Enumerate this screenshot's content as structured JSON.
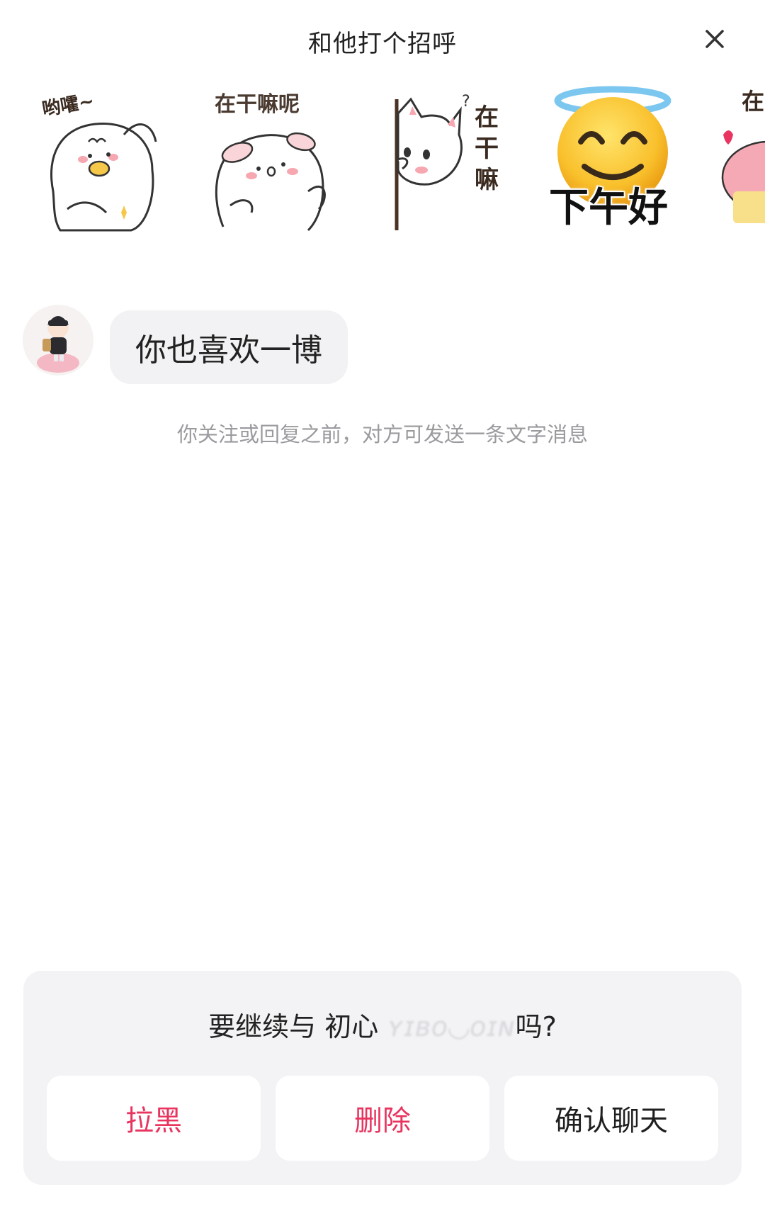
{
  "header": {
    "title": "和他打个招呼",
    "close_icon": "close-icon"
  },
  "stickers": [
    {
      "name": "duck-sticker",
      "caption": "哟嚯~"
    },
    {
      "name": "bunny-sticker",
      "caption": "在干嘛呢"
    },
    {
      "name": "cat-sticker",
      "caption": "在干嘛"
    },
    {
      "name": "angel-emoji-sticker",
      "caption": "下午好"
    },
    {
      "name": "pig-sticker",
      "caption": "在"
    }
  ],
  "chat": {
    "avatar_icon": "user-avatar",
    "message": "你也喜欢一博"
  },
  "hint": "你关注或回复之前，对方可发送一条文字消息",
  "prompt": {
    "prefix": "要继续与 初心 ",
    "name_blurred": "ʏɪʙᴏ◡ᴏɪɴ",
    "suffix": "吗?"
  },
  "actions": {
    "block": "拉黑",
    "delete": "删除",
    "confirm": "确认聊天"
  },
  "colors": {
    "accent_red": "#e8345e",
    "card_bg": "#f3f3f5",
    "bubble_bg": "#f2f2f4",
    "hint_text": "#9a9a9f"
  }
}
